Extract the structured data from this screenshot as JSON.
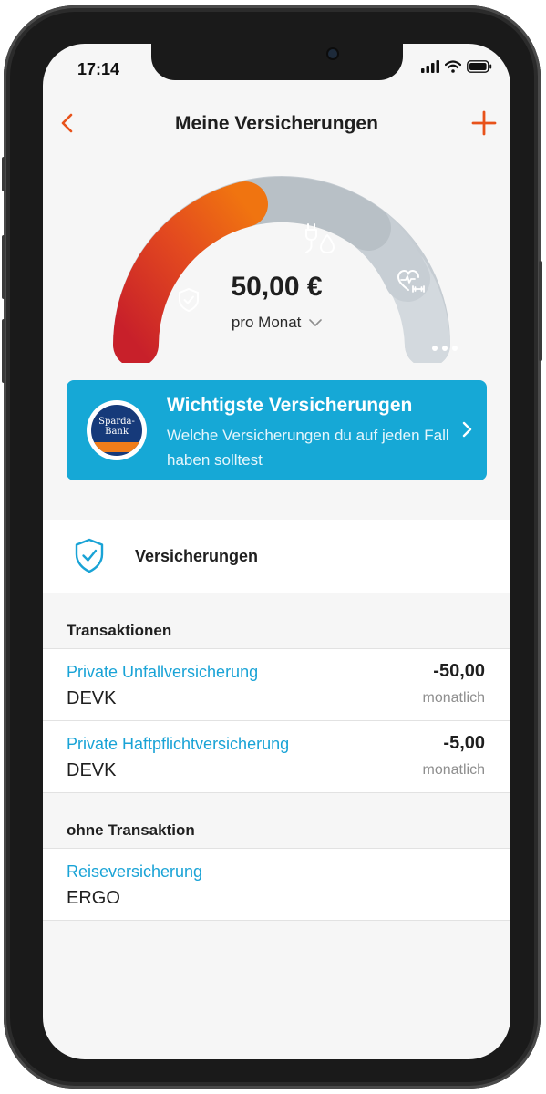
{
  "status_bar": {
    "time": "17:14"
  },
  "nav": {
    "title": "Meine Versicherungen"
  },
  "summary": {
    "amount": "50,00 €",
    "period": "pro Monat"
  },
  "gauge_segments": [
    {
      "category": "Versicherungen",
      "icon": "shield-icon",
      "color": "#e8521a"
    },
    {
      "category": "Energie",
      "icon": "plug-drop-icon",
      "color": "#b9c0c6"
    },
    {
      "category": "Gesundheit",
      "icon": "heart-dumbbell-icon",
      "color": "#c8ced3"
    },
    {
      "category": "Weitere",
      "icon": "more-dots-icon",
      "color": "#d4dadf"
    }
  ],
  "promo": {
    "logo_text_line1": "Sparda-",
    "logo_text_line2": "Bank",
    "title": "Wichtigste Versicherungen",
    "text": "Welche Versicherungen du auf jeden Fall haben solltest",
    "accent": "#16a8d6"
  },
  "insurance_section": {
    "label": "Versicherungen"
  },
  "groups": [
    {
      "title": "Transaktionen",
      "items": [
        {
          "name": "Private Unfallversicherung",
          "provider": "DEVK",
          "amount": "-50,00",
          "frequency": "monatlich"
        },
        {
          "name": "Private Haftpflichtversicherung",
          "provider": "DEVK",
          "amount": "-5,00",
          "frequency": "monatlich"
        }
      ]
    },
    {
      "title": "ohne Transaktion",
      "items": [
        {
          "name": "Reiseversicherung",
          "provider": "ERGO"
        }
      ]
    }
  ],
  "colors": {
    "accent": "#e8521a",
    "link": "#19a3d6",
    "background": "#f6f6f6"
  }
}
